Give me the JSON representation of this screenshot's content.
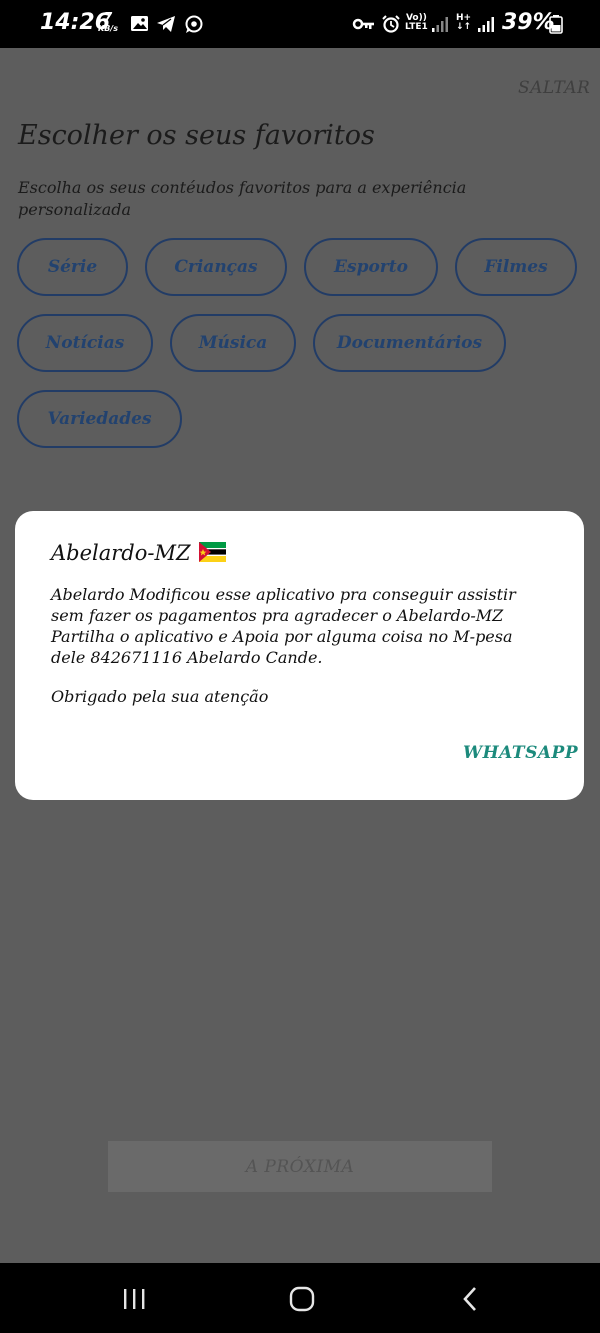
{
  "status_bar": {
    "time": "14:26",
    "net_speed_value": "7",
    "net_speed_unit": "KB/s",
    "volte_top": "Vo))",
    "volte_bottom": "LTE1",
    "network_type_top": "H+",
    "battery": "39%",
    "icons": [
      "gallery-icon",
      "telegram-icon",
      "whatsapp-icon",
      "vpn-key-icon",
      "alarm-icon",
      "signal-icon",
      "battery-icon"
    ]
  },
  "screen": {
    "skip_label": "SALTAR",
    "title": "Escolher os seus favoritos",
    "subtitle": "Escolha os seus contéudos favoritos para a experiência personalizada",
    "categories": [
      "Série",
      "Crianças",
      "Esporto",
      "Filmes",
      "Notícias",
      "Música",
      "Documentários",
      "Variedades"
    ],
    "next_label": "A PRÓXIMA"
  },
  "dialog": {
    "title": "Abelardo-MZ",
    "body": "Abelardo Modificou esse aplicativo pra conseguir assistir sem fazer os pagamentos pra agradecer o Abelardo-MZ Partilha o aplicativo e Apoia por alguma coisa no M-pesa dele 842671116 Abelardo Cande.",
    "thanks": "Obrigado pela sua atenção",
    "button_label": "WHATSAPP"
  },
  "nav_bar": {
    "icons": [
      "recents-icon",
      "home-icon",
      "back-icon"
    ]
  },
  "colors": {
    "overlay": "#5d5d5d",
    "chip_border": "#223c66",
    "chip_text": "#22426f",
    "dialog_bg": "#ffffff",
    "accent": "#1c8a7c"
  }
}
